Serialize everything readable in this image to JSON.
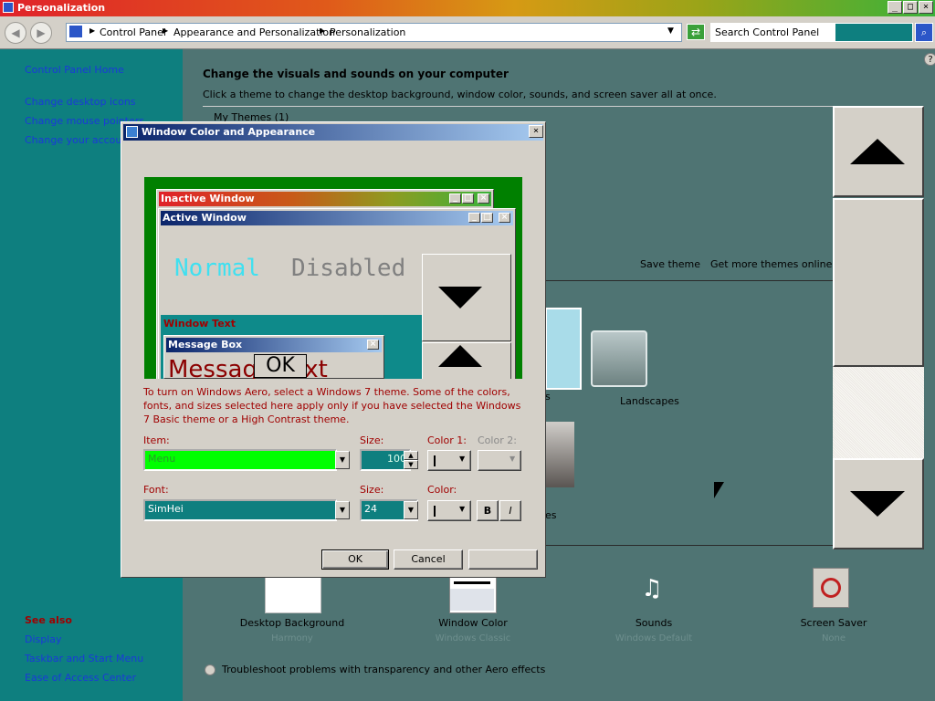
{
  "window": {
    "title": "Personalization"
  },
  "addressbar": {
    "crumbs": [
      "Control Panel",
      "Appearance and Personalization",
      "Personalization"
    ],
    "search_placeholder": "Search Control Panel"
  },
  "left_pane": {
    "links": [
      "Control Panel Home",
      "Change desktop icons",
      "Change mouse pointers",
      "Change your account picture"
    ],
    "see_also_heading": "See also",
    "see_also": [
      "Display",
      "Taskbar and Start Menu",
      "Ease of Access Center"
    ]
  },
  "main": {
    "headline": "Change the visuals and sounds on your computer",
    "subline": "Click a theme to change the desktop background, window color, sounds, and screen saver all at once.",
    "my_themes": "My Themes (1)",
    "save_theme": "Save theme",
    "get_more": "Get more themes online",
    "theme_landscapes": "Landscapes",
    "theme_s_fragment": "s",
    "theme_es_fragment": "es",
    "bottom": [
      {
        "label": "Desktop Background",
        "sub": "Harmony"
      },
      {
        "label": "Window Color",
        "sub": "Windows Classic"
      },
      {
        "label": "Sounds",
        "sub": "Windows Default"
      },
      {
        "label": "Screen Saver",
        "sub": "None"
      }
    ],
    "troubleshoot": "Troubleshoot problems with transparency and other Aero effects"
  },
  "dialog": {
    "title": "Window Color and Appearance",
    "preview": {
      "inactive_title": "Inactive Window",
      "active_title": "Active Window",
      "normal": "Normal",
      "disabled": "Disabled",
      "window_text": "Window Text",
      "msgbox_title": "Message Box",
      "msgbox_text": "Message Text",
      "ok": "OK"
    },
    "info": "To turn on Windows Aero, select a Windows 7 theme.  Some of the colors, fonts, and sizes selected here apply only if you have selected the Windows 7 Basic theme or a High Contrast theme.",
    "item_label": "Item:",
    "item_value": "Menu",
    "size_label": "Size:",
    "size_value": "100",
    "color1_label": "Color 1:",
    "color2_label": "Color 2:",
    "font_label": "Font:",
    "font_value": "SimHei",
    "font_size_label": "Size:",
    "font_size_value": "24",
    "font_color_label": "Color:",
    "bold": "B",
    "italic": "I",
    "ok": "OK",
    "cancel": "Cancel"
  },
  "colors": {
    "desktop_teal": "#0e7f7f",
    "main_gray": "#4f7473",
    "link_blue": "#1a3ad8",
    "item_green": "#00ff00"
  }
}
